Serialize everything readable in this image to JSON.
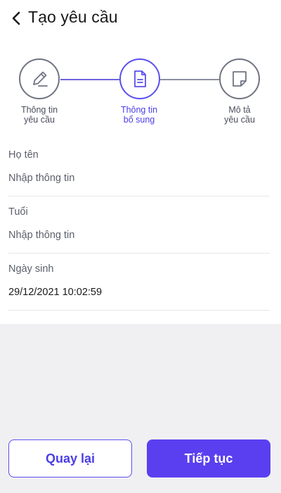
{
  "header": {
    "title": "Tạo yêu cầu",
    "back_icon": "chevron-left-icon"
  },
  "stepper": {
    "steps": [
      {
        "label_line1": "Thông tin",
        "label_line2": "yêu cầu",
        "icon": "pencil-icon",
        "state": "completed"
      },
      {
        "label_line1": "Thông tin",
        "label_line2": "bổ sung",
        "icon": "document-icon",
        "state": "active"
      },
      {
        "label_line1": "Mô tả",
        "label_line2": "yêu cầu",
        "icon": "note-icon",
        "state": "pending"
      }
    ]
  },
  "form": {
    "fields": [
      {
        "label": "Họ tên",
        "value": "",
        "placeholder": "Nhập thông tin"
      },
      {
        "label": "Tuổi",
        "value": "",
        "placeholder": "Nhập thông tin"
      },
      {
        "label": "Ngày sinh",
        "value": "29/12/2021 10:02:59",
        "placeholder": ""
      }
    ]
  },
  "actions": {
    "back_label": "Quay lại",
    "next_label": "Tiếp tục"
  },
  "colors": {
    "accent": "#5a3ff0",
    "text": "#1a1a1a",
    "muted": "#5b5f6b",
    "footer_bg": "#f0f0f2"
  }
}
